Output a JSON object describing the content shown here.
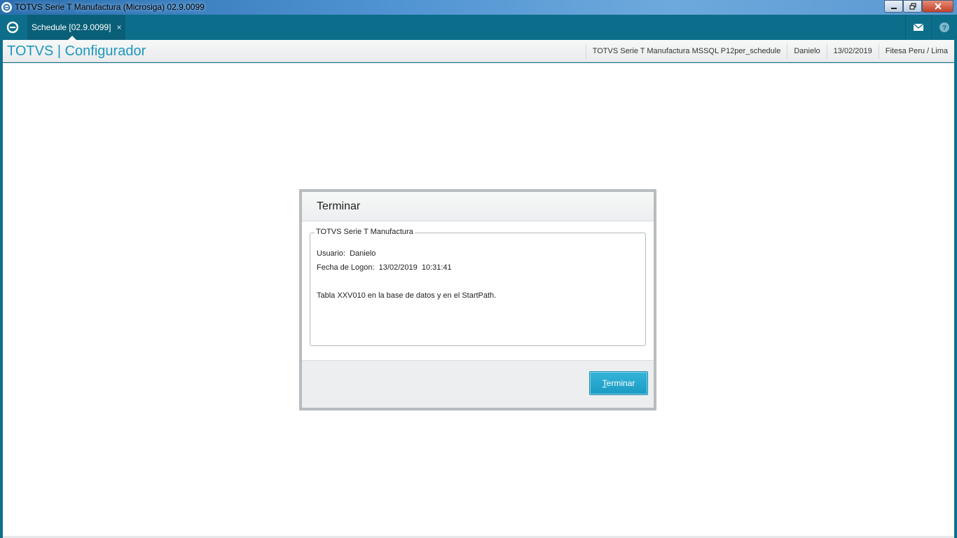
{
  "window": {
    "title": "TOTVS Serie T Manufactura (Microsiga) 02.9.0099"
  },
  "tabbar": {
    "tab_label": "Schedule [02.9.0099]",
    "tab_close": "×"
  },
  "header": {
    "brand": "TOTVS | Configurador",
    "environment": "TOTVS Serie T Manufactura MSSQL P12per_schedule",
    "user": "Danielo",
    "date": "13/02/2019",
    "branch": "Fitesa Peru / Lima"
  },
  "dialog": {
    "title": "Terminar",
    "group_label": "TOTVS Serie T Manufactura",
    "user_line": "Usuario:  Danielo",
    "logon_line": "Fecha de Logon:  13/02/2019  10:31:41",
    "message": "Tabla XXV010 en la base de datos y en el StartPath.",
    "button_accel": "T",
    "button_rest": "erminar"
  },
  "colors": {
    "accent": "#0c6e8a",
    "brand_text": "#1c98c0",
    "button": "#1a9bc3"
  }
}
